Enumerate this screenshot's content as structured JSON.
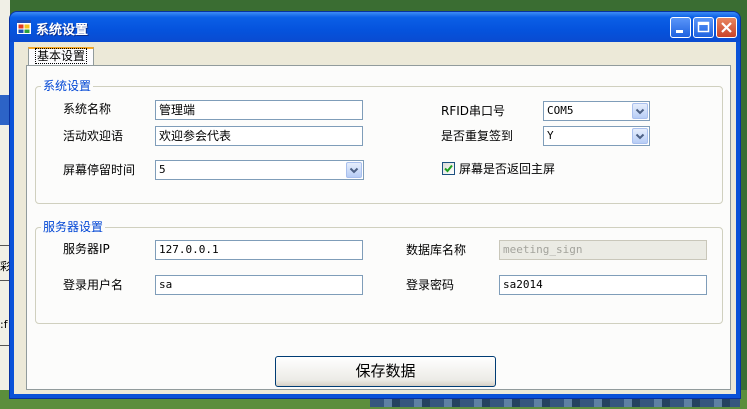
{
  "window": {
    "title": "系统设置"
  },
  "tabs": [
    {
      "label": "基本设置"
    }
  ],
  "system_group": {
    "title": "系统设置",
    "system_name_label": "系统名称",
    "system_name_value": "管理端",
    "welcome_label": "活动欢迎语",
    "welcome_value": "欢迎参会代表",
    "screen_time_label": "屏幕停留时间",
    "screen_time_value": "5",
    "rfid_label": "RFID串口号",
    "rfid_value": "COM5",
    "repeat_label": "是否重复签到",
    "repeat_value": "Y",
    "return_home_label": "屏幕是否返回主屏",
    "return_home_checked": true
  },
  "server_group": {
    "title": "服务器设置",
    "server_ip_label": "服务器IP",
    "server_ip_value": "127.0.0.1",
    "db_name_label": "数据库名称",
    "db_name_value": "meeting_sign",
    "username_label": "登录用户名",
    "username_value": "sa",
    "password_label": "登录密码",
    "password_value": "sa2014"
  },
  "save_button": {
    "label": "保存数据"
  },
  "background": {
    "frag1": "彩",
    "frag2": ":f"
  },
  "colors": {
    "group_title": "#0046d5",
    "titlebar": "#0553dd",
    "client": "#ece9d8"
  }
}
